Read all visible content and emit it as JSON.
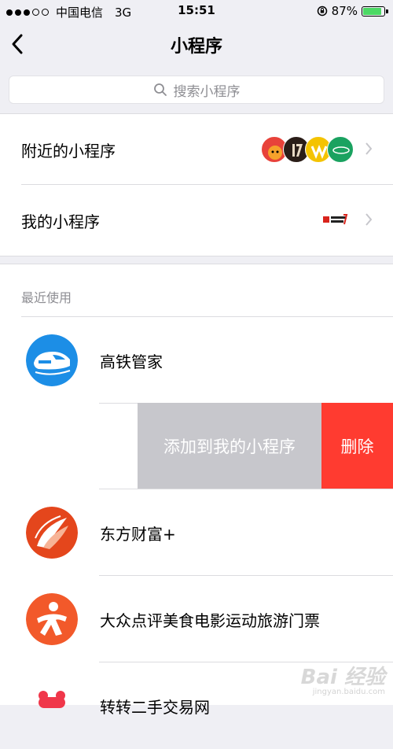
{
  "status_bar": {
    "carrier": "中国电信",
    "network": "3G",
    "time": "15:51",
    "battery": "87%",
    "battery_level": 0.87
  },
  "nav": {
    "title": "小程序"
  },
  "search": {
    "placeholder": "搜索小程序"
  },
  "cells": [
    {
      "label": "附近的小程序"
    },
    {
      "label": "我的小程序"
    }
  ],
  "recent": {
    "header": "最近使用",
    "apps": [
      {
        "name": "高铁管家"
      },
      {
        "name": "东方财富+"
      },
      {
        "name": "大众点评美食电影运动旅游门票"
      },
      {
        "name": "转转二手交易网"
      }
    ],
    "swipe_actions": {
      "add_label": "添加到我的小程序",
      "delete_label": "删除"
    }
  },
  "watermark": {
    "main": "Bai 经验",
    "sub": "jingyan.baidu.com"
  },
  "colors": {
    "background": "#efeff4",
    "delete": "#ff3b30",
    "add": "#c7c7cc",
    "battery": "#4cd964"
  }
}
